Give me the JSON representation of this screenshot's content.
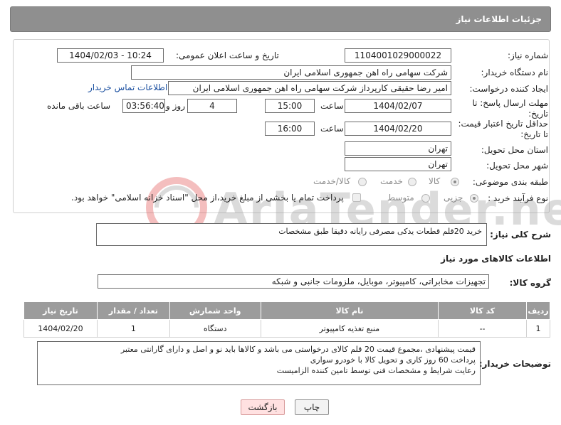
{
  "header": {
    "title": "جزئیات اطلاعات نیاز"
  },
  "form": {
    "need_number": {
      "label": "شماره نیاز:",
      "value": "1104001029000022"
    },
    "announce": {
      "label": "تاریخ و ساعت اعلان عمومی:",
      "value": "1404/02/03 - 10:24"
    },
    "buyer_org": {
      "label": "نام دستگاه خریدار:",
      "value": "شرکت سهامی راه اهن جمهوری اسلامی ایران"
    },
    "requester": {
      "label": "ایجاد کننده درخواست:",
      "value": "امیر رضا  حقیقی کارپرداز شرکت سهامی راه اهن جمهوری اسلامی ایران",
      "contact_link": "اطلاعات تماس خریدار"
    },
    "deadline": {
      "label_line1": "مهلت ارسال پاسخ: تا",
      "label_line2": "تاریخ:",
      "date": "1404/02/07",
      "time_label": "ساعت",
      "time": "15:00",
      "days": "4",
      "days_label": "روز و",
      "remaining": "03:56:40",
      "remaining_label": "ساعت باقی مانده"
    },
    "price_validity": {
      "label_line1": "حداقل تاریخ اعتبار قیمت:",
      "label_line2": "تا تاریخ:",
      "date": "1404/02/20",
      "time_label": "ساعت",
      "time": "16:00"
    },
    "province": {
      "label": "استان محل تحویل:",
      "value": "تهران"
    },
    "city": {
      "label": "شهر محل تحویل:",
      "value": "تهران"
    },
    "category": {
      "label": "طبقه بندی موضوعی:",
      "options": [
        {
          "label": "کالا",
          "selected": true
        },
        {
          "label": "خدمت",
          "selected": false
        },
        {
          "label": "کالا/خدمت",
          "selected": false
        }
      ]
    },
    "process": {
      "label": "نوع فرآیند خرید :",
      "options": [
        {
          "label": "جزیی",
          "selected": true
        },
        {
          "label": "متوسط",
          "selected": false
        }
      ],
      "note": "پرداخت تمام یا بخشی از مبلغ خرید،از محل \"اسناد خزانه اسلامی\" خواهد بود."
    }
  },
  "description": {
    "label": "شرح کلی نیاز:",
    "value": "خرید 20قلم قطعات یدکی مصرفی رایانه دقیقا طبق مشخصات"
  },
  "goods_section": {
    "title": "اطلاعات کالاهای مورد نیاز",
    "group_label": "گروه کالا:",
    "group_value": "تجهیزات مخابراتی، کامپیوتر، موبایل، ملزومات جانبی و شبکه",
    "columns": [
      "ردیف",
      "کد کالا",
      "نام کالا",
      "واحد شمارش",
      "تعداد / مقدار",
      "تاریخ نیاز"
    ],
    "rows": [
      {
        "row": "1",
        "code": "--",
        "name": "منبع تغذیه کامپیوتر",
        "unit": "دستگاه",
        "qty": "1",
        "date": "1404/02/20"
      }
    ]
  },
  "buyer_notes": {
    "label": "توضیحات خریدار:",
    "lines": [
      "قیمت پیشنهادی ،مجموع قیمت 20 قلم کالای درخواستی می باشد و کالاها باید نو و اصل و دارای گارانتی معتبر",
      "پرداخت 60 روز کاری و تحویل کالا با خودرو سواری",
      "رعایت شرایط و مشخصات فنی توسط تامین کننده الزامیست"
    ]
  },
  "buttons": {
    "print": "چاپ",
    "back": "بازگشت"
  },
  "watermark": {
    "text": "AriaTender.net",
    "color": "#c8c8c8",
    "accent": "#e04848"
  }
}
